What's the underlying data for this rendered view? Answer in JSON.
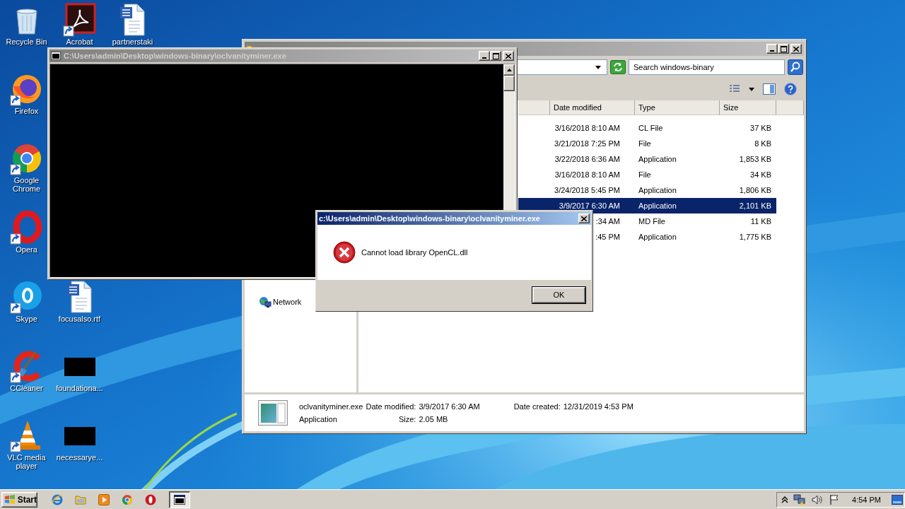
{
  "desktop": {
    "columns": [
      {
        "icons": [
          {
            "label": "Recycle Bin",
            "kind": "recycle",
            "shortcut": false
          },
          {
            "label": "Firefox",
            "kind": "firefox",
            "shortcut": true
          },
          {
            "label": "Google Chrome",
            "kind": "chrome",
            "shortcut": true
          },
          {
            "label": "Opera",
            "kind": "opera",
            "shortcut": true
          },
          {
            "label": "Skype",
            "kind": "skype",
            "shortcut": true
          },
          {
            "label": "CCleaner",
            "kind": "ccleaner",
            "shortcut": true
          },
          {
            "label": "VLC media player",
            "kind": "vlc",
            "shortcut": true
          }
        ]
      },
      {
        "icons": [
          {
            "label": "Acrobat",
            "kind": "acrobat",
            "shortcut": true
          },
          {
            "label": "focusalso.rtf",
            "kind": "document",
            "shortcut": false
          },
          {
            "label": "foundationa...",
            "kind": "blank",
            "shortcut": false
          },
          {
            "label": "necessarye...",
            "kind": "blank",
            "shortcut": false
          }
        ]
      },
      {
        "icons": [
          {
            "label": "partnerstaki",
            "kind": "document",
            "shortcut": false
          }
        ]
      }
    ]
  },
  "console_window": {
    "title": "C:\\Users\\admin\\Desktop\\windows-binary\\oclvanityminer.exe"
  },
  "explorer": {
    "search": {
      "placeholder": "Search windows-binary"
    },
    "columns": [
      "Date modified",
      "Type",
      "Size"
    ],
    "rows": [
      {
        "date": "3/16/2018 8:10 AM",
        "type": "CL File",
        "size": "37 KB",
        "selected": false
      },
      {
        "date": "3/21/2018 7:25 PM",
        "type": "File",
        "size": "8 KB",
        "selected": false
      },
      {
        "date": "3/22/2018 6:36 AM",
        "type": "Application",
        "size": "1,853 KB",
        "selected": false
      },
      {
        "date": "3/16/2018 8:10 AM",
        "type": "File",
        "size": "34 KB",
        "selected": false
      },
      {
        "date": "3/24/2018 5:45 PM",
        "type": "Application",
        "size": "1,806 KB",
        "selected": false
      },
      {
        "date": "3/9/2017 6:30 AM",
        "type": "Application",
        "size": "2,101 KB",
        "selected": true
      },
      {
        "date": ":34 AM",
        "type": "MD File",
        "size": "11 KB",
        "selected": false
      },
      {
        "date": ":45 PM",
        "type": "Application",
        "size": "1,775 KB",
        "selected": false
      }
    ],
    "navigation": [
      {
        "label": "Network"
      }
    ],
    "details": {
      "name": "oclvanityminer.exe",
      "type": "Application",
      "fields": [
        {
          "label": "Date modified:",
          "value": "3/9/2017 6:30 AM"
        },
        {
          "label": "Date created:",
          "value": "12/31/2019 4:53 PM"
        },
        {
          "label": "Size:",
          "value": "2.05 MB"
        }
      ]
    }
  },
  "dialog": {
    "title": "c:\\Users\\admin\\Desktop\\windows-binary\\oclvanityminer.exe",
    "message": "Cannot load library OpenCL.dll",
    "buttons": [
      {
        "label": "OK",
        "default": true
      }
    ]
  },
  "taskbar": {
    "start_label": "Start",
    "tasks": [
      {
        "kind": "console",
        "selected": true
      }
    ],
    "clock": "4:54 PM"
  }
}
